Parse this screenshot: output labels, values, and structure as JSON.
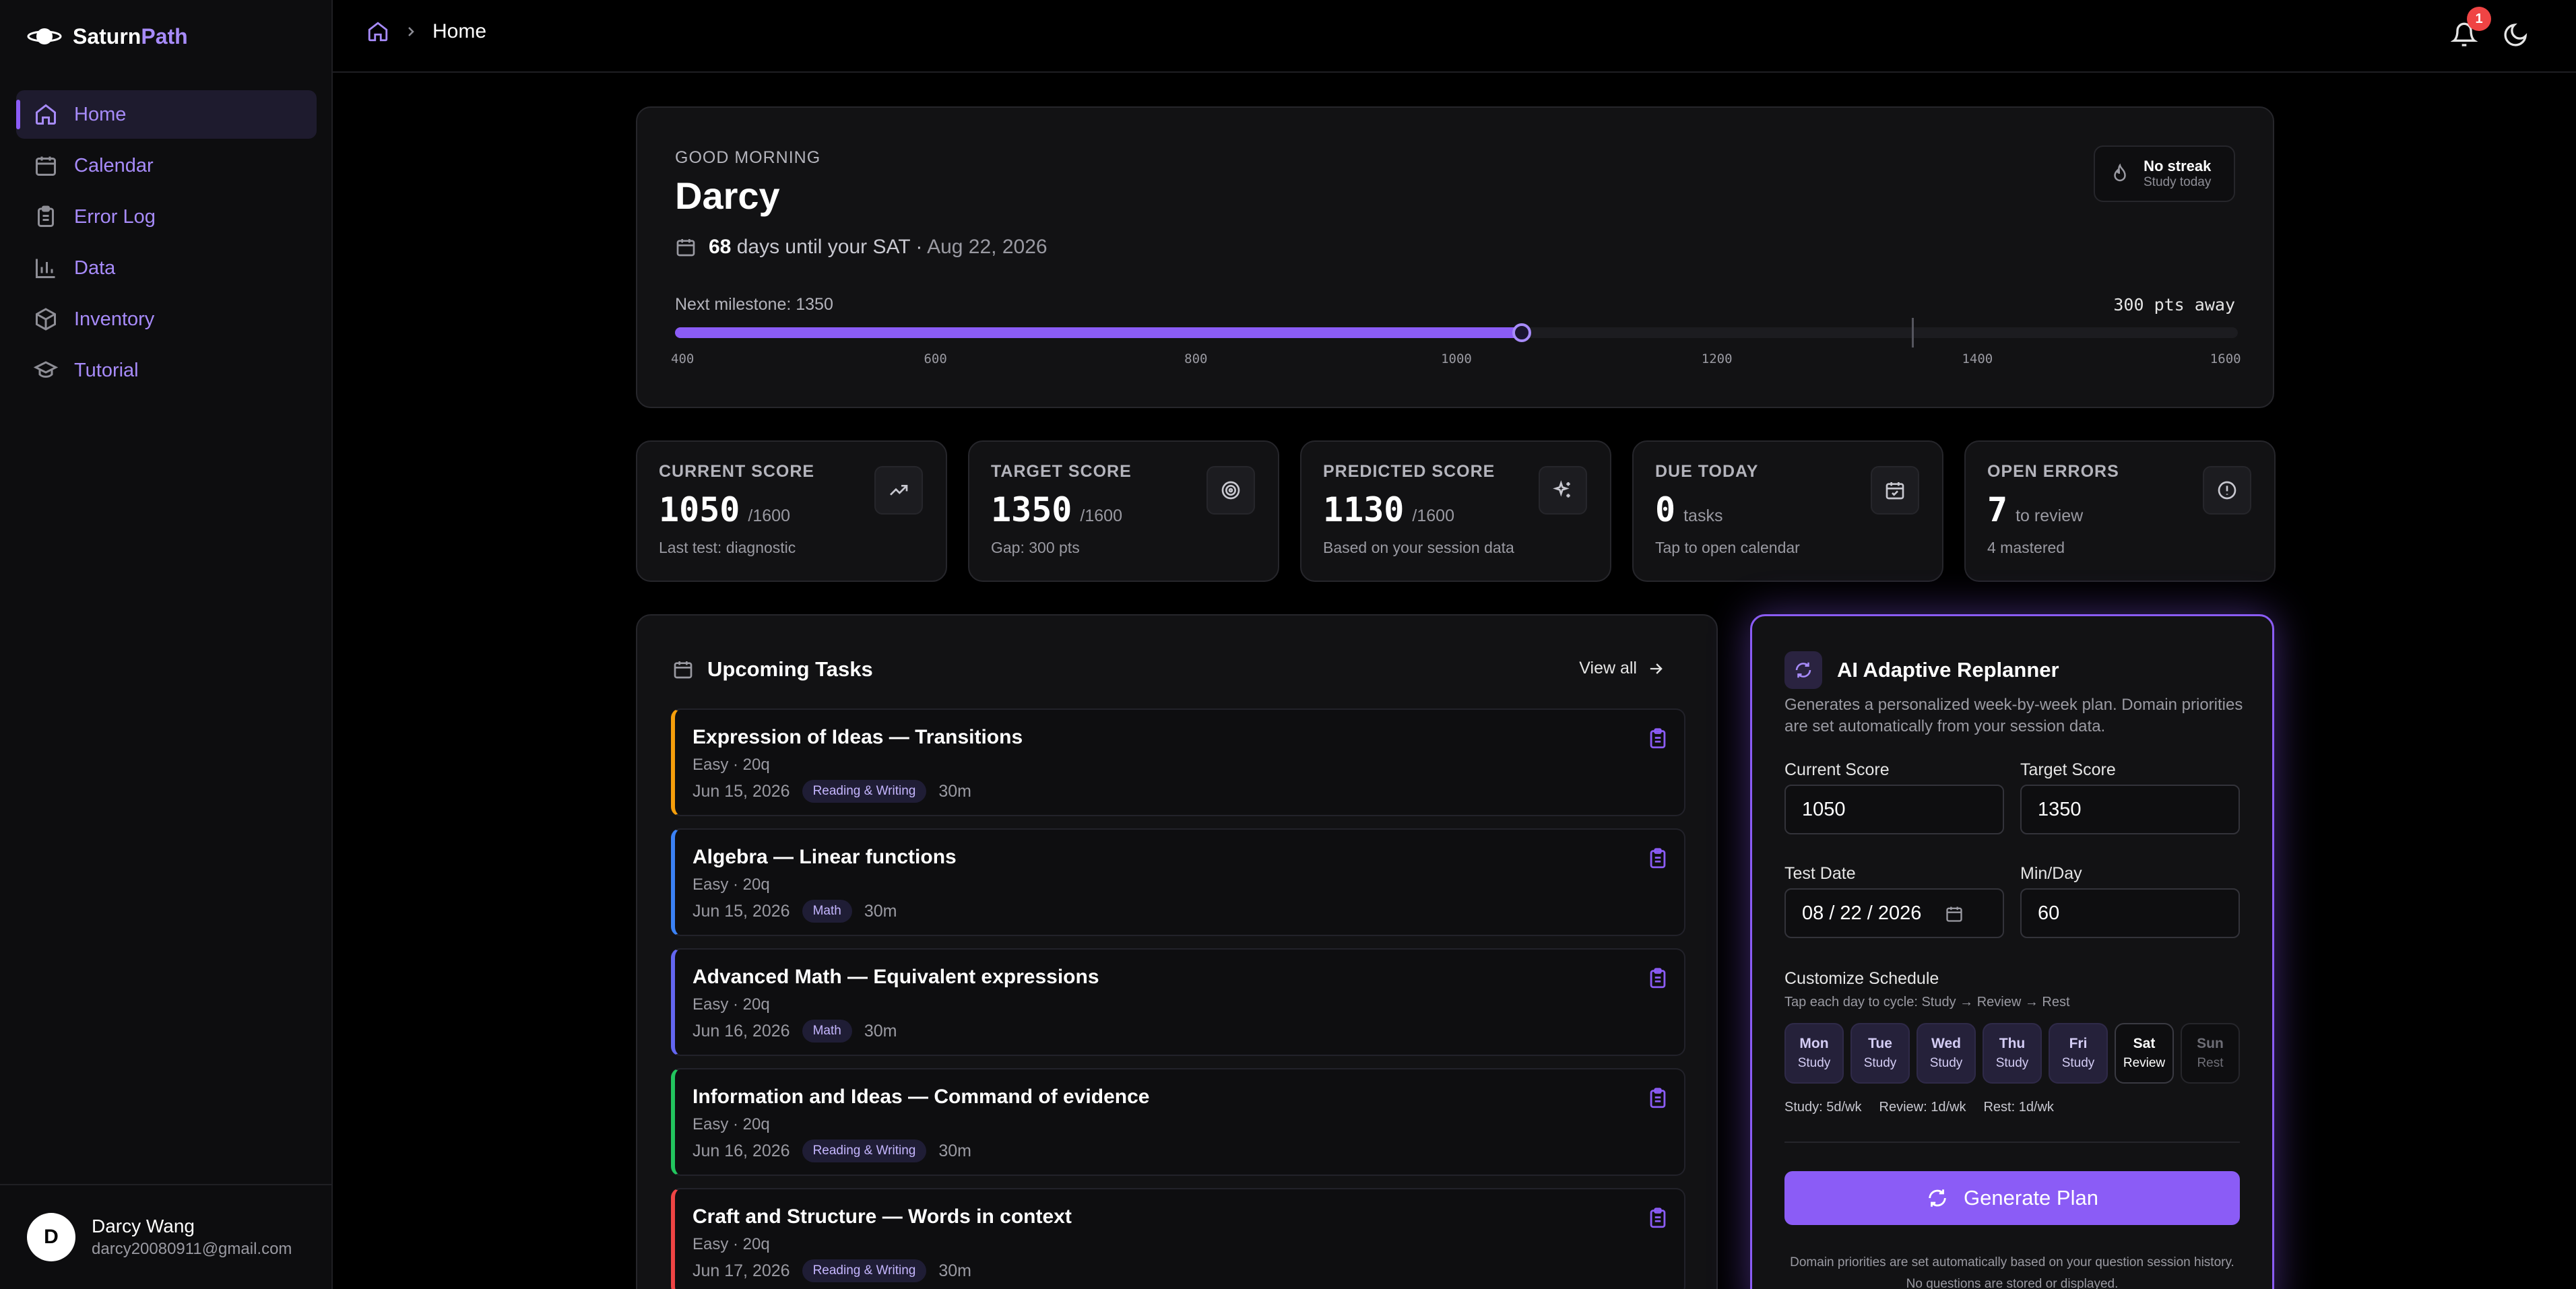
{
  "app": {
    "brand_a": "Saturn",
    "brand_b": "Path"
  },
  "sidebar": {
    "items": [
      {
        "label": "Home",
        "icon": "home-icon"
      },
      {
        "label": "Calendar",
        "icon": "calendar-icon"
      },
      {
        "label": "Error Log",
        "icon": "clipboard-icon"
      },
      {
        "label": "Data",
        "icon": "bar-chart-icon"
      },
      {
        "label": "Inventory",
        "icon": "package-icon"
      },
      {
        "label": "Tutorial",
        "icon": "graduation-cap-icon"
      }
    ],
    "active": "Home"
  },
  "user": {
    "initial": "D",
    "name": "Darcy Wang",
    "email": "darcy20080911@gmail.com"
  },
  "topbar": {
    "breadcrumb": "Home",
    "notification_count": "1"
  },
  "hero": {
    "greeting": "GOOD MORNING",
    "name": "Darcy",
    "days_count": "68",
    "days_text": "days until your SAT ·",
    "test_date": "Aug 22, 2026",
    "streak_title": "No streak",
    "streak_sub": "Study today",
    "milestone": "Next milestone: 1350",
    "away": "300 pts away",
    "progress": {
      "min": 400,
      "max": 1600,
      "current": 1050,
      "milestone": 1350
    },
    "ticks": [
      "400",
      "600",
      "800",
      "1000",
      "1200",
      "1400",
      "1600"
    ]
  },
  "stats": [
    {
      "label": "CURRENT SCORE",
      "value": "1050",
      "unit": "/1600",
      "sub": "Last test: diagnostic",
      "icon": "trending-up-icon"
    },
    {
      "label": "TARGET SCORE",
      "value": "1350",
      "unit": "/1600",
      "sub": "Gap: 300 pts",
      "icon": "target-icon"
    },
    {
      "label": "PREDICTED SCORE",
      "value": "1130",
      "unit": "/1600",
      "sub": "Based on your session data",
      "icon": "sparkles-icon"
    },
    {
      "label": "DUE TODAY",
      "value": "0",
      "unit": "tasks",
      "sub": "Tap to open calendar",
      "icon": "calendar-check-icon"
    },
    {
      "label": "OPEN ERRORS",
      "value": "7",
      "unit": "to review",
      "sub": "4 mastered",
      "icon": "alert-circle-icon"
    }
  ],
  "tasks": {
    "title": "Upcoming Tasks",
    "view_all": "View all",
    "items": [
      {
        "title": "Expression of Ideas — Transitions",
        "meta": "Easy · 20q",
        "date": "Jun 15, 2026",
        "tag": "Reading & Writing",
        "duration": "30m",
        "accent": "#f59e0b"
      },
      {
        "title": "Algebra — Linear functions",
        "meta": "Easy · 20q",
        "date": "Jun 15, 2026",
        "tag": "Math",
        "duration": "30m",
        "accent": "#3b82f6"
      },
      {
        "title": "Advanced Math — Equivalent expressions",
        "meta": "Easy · 20q",
        "date": "Jun 16, 2026",
        "tag": "Math",
        "duration": "30m",
        "accent": "#6366f1"
      },
      {
        "title": "Information and Ideas — Command of evidence",
        "meta": "Easy · 20q",
        "date": "Jun 16, 2026",
        "tag": "Reading & Writing",
        "duration": "30m",
        "accent": "#22c55e"
      },
      {
        "title": "Craft and Structure — Words in context",
        "meta": "Easy · 20q",
        "date": "Jun 17, 2026",
        "tag": "Reading & Writing",
        "duration": "30m",
        "accent": "#ef4444"
      }
    ]
  },
  "planner": {
    "title": "AI Adaptive Replanner",
    "description": "Generates a personalized week-by-week plan. Domain priorities are set automatically from your session data.",
    "current_label": "Current Score",
    "current_value": "1050",
    "target_label": "Target Score",
    "target_value": "1350",
    "date_label": "Test Date",
    "date_value": "08 / 22 / 2026",
    "min_label": "Min/Day",
    "min_value": "60",
    "custom_title": "Customize Schedule",
    "custom_sub": "Tap each day to cycle: Study → Review → Rest",
    "days": [
      {
        "day": "Mon",
        "mode": "Study"
      },
      {
        "day": "Tue",
        "mode": "Study"
      },
      {
        "day": "Wed",
        "mode": "Study"
      },
      {
        "day": "Thu",
        "mode": "Study"
      },
      {
        "day": "Fri",
        "mode": "Study"
      },
      {
        "day": "Sat",
        "mode": "Review"
      },
      {
        "day": "Sun",
        "mode": "Rest"
      }
    ],
    "summary_study": "Study: 5d/wk",
    "summary_review": "Review: 1d/wk",
    "summary_rest": "Rest: 1d/wk",
    "button": "Generate Plan",
    "footnote": "Domain priorities are set automatically based on your question session history. No questions are stored or displayed."
  },
  "colors": {
    "accent": "#8b5cf6",
    "accent_light": "#a78bfa",
    "background": "#000000",
    "card": "#121214"
  }
}
